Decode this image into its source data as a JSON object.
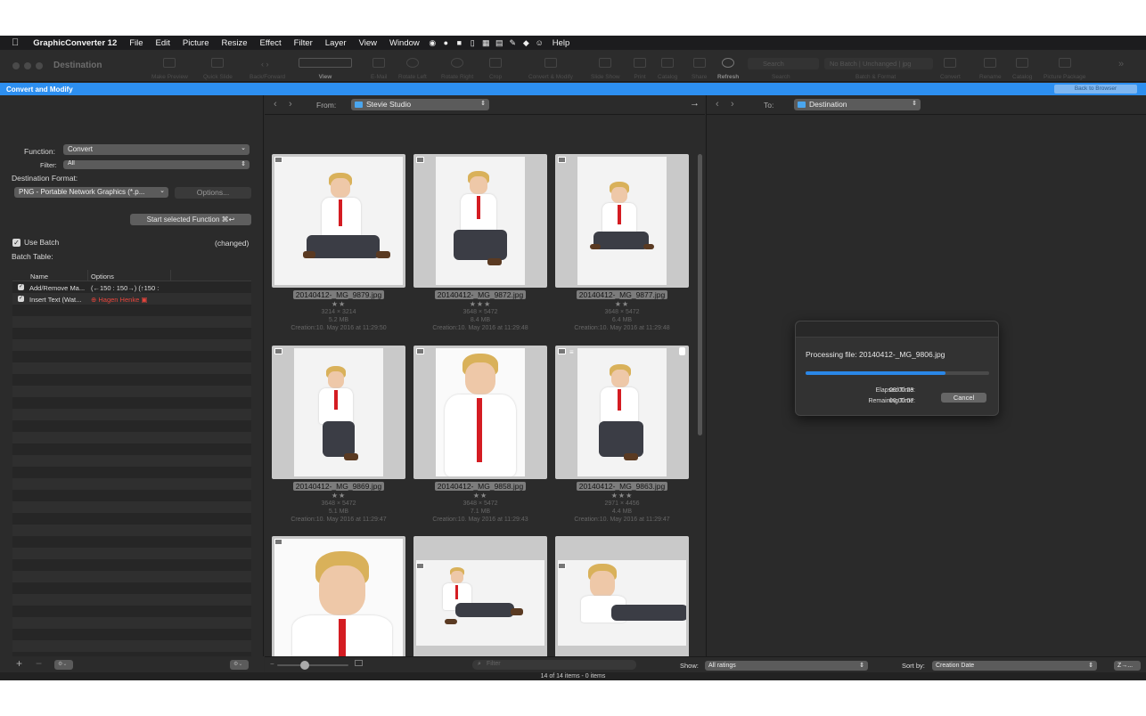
{
  "menubar": {
    "app_name": "GraphicConverter 12",
    "items": [
      "File",
      "Edit",
      "Picture",
      "Resize",
      "Effect",
      "Filter",
      "Layer",
      "View",
      "Window"
    ],
    "help": "Help",
    "status_icons": [
      "target-icon",
      "person-icon",
      "camera-icon",
      "clipboard-icon",
      "calendar-icon",
      "calendar2-icon",
      "wand-icon",
      "diamond-icon",
      "smiley-icon"
    ]
  },
  "window": {
    "title": "Destination",
    "toolbar": {
      "make_preview": "Make Preview",
      "quick_slide": "Quick Slide",
      "back_forward": "Back/Forward",
      "view": "View",
      "email": "E-Mail",
      "rotate_left": "Rotate Left",
      "rotate_right": "Rotate Right",
      "crop": "Crop",
      "convert_modify": "Convert & Modify",
      "slide_show": "Slide Show",
      "print": "Print",
      "catalog": "Catalog",
      "share": "Share",
      "refresh": "Refresh",
      "search_label": "Search",
      "search_placeholder": "Search",
      "batch_label": "Batch & Format",
      "batch_value": "No Batch | Unchanged | jpg",
      "convert": "Convert",
      "rename": "Rename",
      "catalog2": "Catalog",
      "picture_package": "Picture Package"
    }
  },
  "panel": {
    "title": "Convert and Modify",
    "back_button": "Back to Browser",
    "function_label": "Function:",
    "function_value": "Convert",
    "filter_label": "Filter:",
    "filter_value": "All",
    "dest_format_label": "Destination Format:",
    "dest_format_value": "PNG - Portable Network Graphics (*.p...",
    "options_button": "Options...",
    "start_button": "Start selected Function",
    "start_shortcut": "⌘↩",
    "use_batch_label": "Use Batch",
    "use_batch_checked": true,
    "changed_label": "(changed)",
    "batch_table_label": "Batch Table:",
    "columns": [
      "Name",
      "Options"
    ],
    "rows": [
      {
        "name": "Add/Remove Ma...",
        "options": "(←150 : 150→) (↑150 :",
        "checked": true
      },
      {
        "name": "Insert Text (Wat...",
        "options": "Hagen Henke",
        "checked": true
      }
    ],
    "add": "+",
    "remove": "−"
  },
  "browser": {
    "from_label": "From:",
    "from_folder": "Stevie Studio",
    "to_label": "To:",
    "to_folder": "Destination",
    "thumbnails": [
      {
        "name": "20140412-_MG_9879.jpg",
        "dims": "3214 × 3214",
        "size": "5.2 MB",
        "date": "Creation:10. May 2016 at 11:29:50",
        "stars": "★★"
      },
      {
        "name": "20140412-_MG_9872.jpg",
        "dims": "3648 × 5472",
        "size": "8.4 MB",
        "date": "Creation:10. May 2016 at 11:29:48",
        "stars": "★★★"
      },
      {
        "name": "20140412-_MG_9877.jpg",
        "dims": "3648 × 5472",
        "size": "6.4 MB",
        "date": "Creation:10. May 2016 at 11:29:48",
        "stars": "★★"
      },
      {
        "name": "20140412-_MG_9869.jpg",
        "dims": "3648 × 5472",
        "size": "5.1 MB",
        "date": "Creation:10. May 2016 at 11:29:47",
        "stars": "★★"
      },
      {
        "name": "20140412-_MG_9858.jpg",
        "dims": "3648 × 5472",
        "size": "7.1 MB",
        "date": "Creation:10. May 2016 at 11:29:43",
        "stars": "★★"
      },
      {
        "name": "20140412-_MG_9863.jpg",
        "dims": "2971 × 4456",
        "size": "4.4 MB",
        "date": "Creation:10. May 2016 at 11:29:47",
        "stars": "★★★"
      },
      {
        "name": "",
        "dims": "",
        "size": "",
        "date": "",
        "stars": ""
      },
      {
        "name": "",
        "dims": "",
        "size": "",
        "date": "",
        "stars": ""
      },
      {
        "name": "",
        "dims": "",
        "size": "",
        "date": "",
        "stars": ""
      }
    ],
    "filter_placeholder": "Filter",
    "show_label": "Show:",
    "show_value": "All ratings",
    "sort_label": "Sort by:",
    "sort_value": "Creation Date",
    "sort_order": "Z→...",
    "status": "14 of 14 items - 0 items"
  },
  "dialog": {
    "processing": "Processing file: 20140412-_MG_9806.jpg",
    "progress": 0.76,
    "elapsed_label": "Elapsed Time:",
    "elapsed_value": "00:00:23",
    "remaining_label": "Remaining Time:",
    "remaining_value": "00:00:07",
    "cancel": "Cancel"
  },
  "colors": {
    "accent": "#2d8ff0",
    "progress": "#2a87e8",
    "tie": "#d41c22"
  }
}
